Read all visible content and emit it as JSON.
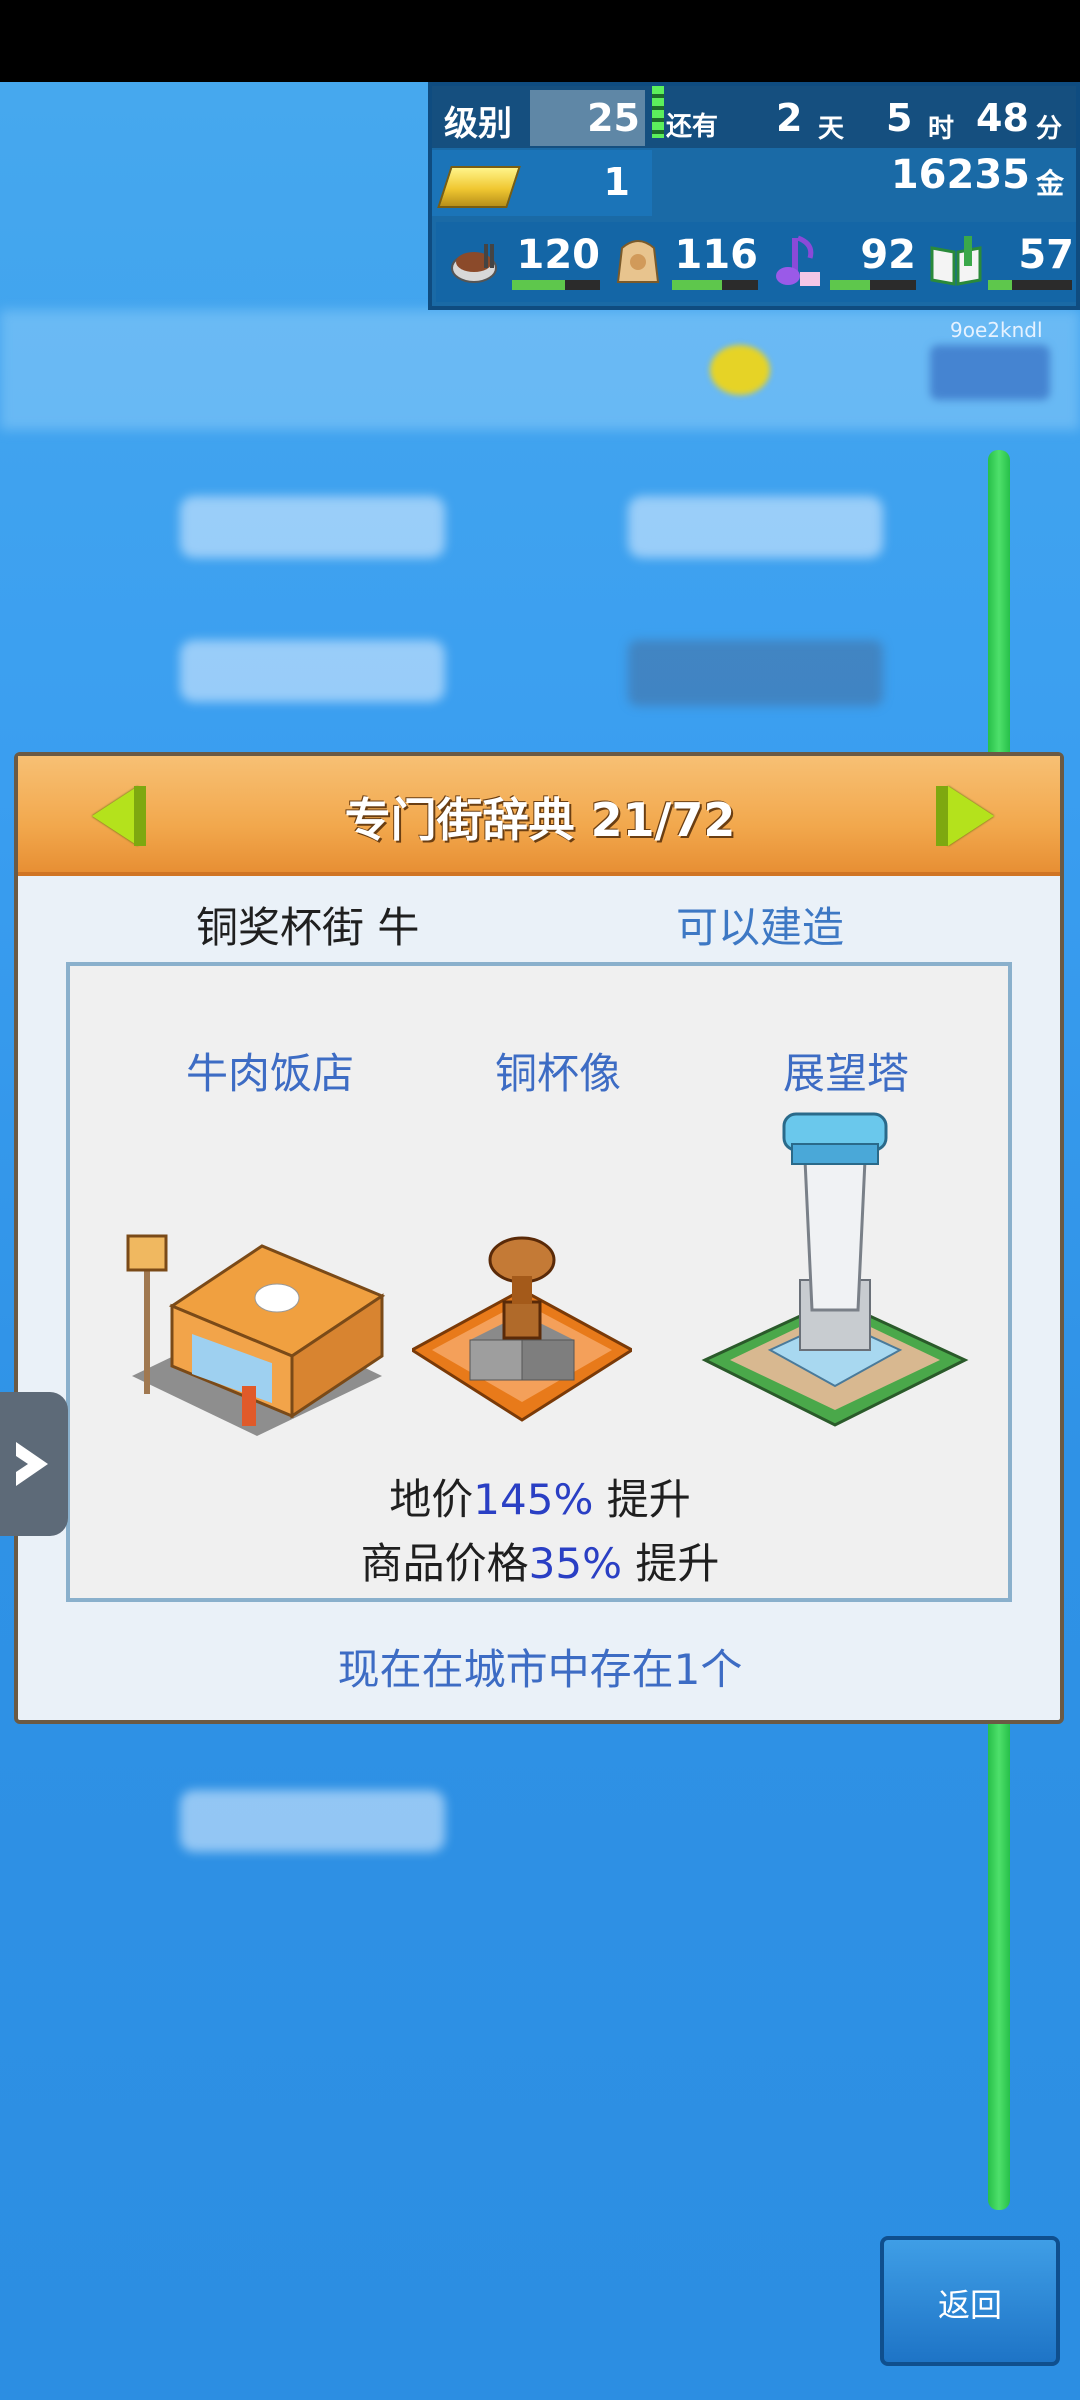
{
  "hud": {
    "level_label": "级别",
    "level_value": "25",
    "remaining_label": "还有",
    "days": "2",
    "days_unit": "天",
    "hours": "5",
    "hours_unit": "时",
    "minutes": "48",
    "minutes_unit": "分",
    "gold_count": "1",
    "money": "16235",
    "money_unit": "金",
    "stats": [
      {
        "icon": "food-icon",
        "value": "120",
        "fill": 0.6
      },
      {
        "icon": "goods-bag-icon",
        "value": "116",
        "fill": 0.58
      },
      {
        "icon": "music-note-icon",
        "value": "92",
        "fill": 0.46
      },
      {
        "icon": "book-icon",
        "value": "57",
        "fill": 0.28
      }
    ]
  },
  "user_id": "9oe2kndl",
  "dialog": {
    "title": "专门街辞典 21/72",
    "street_name": "铜奖杯街 牛",
    "status": "可以建造",
    "buildings": [
      {
        "name": "牛肉饭店",
        "icon": "beef-restaurant-icon"
      },
      {
        "name": "铜杯像",
        "icon": "bronze-cup-statue-icon"
      },
      {
        "name": "展望塔",
        "icon": "observation-tower-icon"
      }
    ],
    "effect1_prefix": "地价",
    "effect1_value": "145%",
    "effect1_suffix": " 提升",
    "effect2_prefix": "商品价格",
    "effect2_value": "35%",
    "effect2_suffix": " 提升",
    "exist_count": "现在在城市中存在1个"
  },
  "back_button": "返回",
  "colors": {
    "header_orange": "#f2a84d",
    "blue_text": "#3d6cc4",
    "highlight": "#2a3fc4",
    "arrow_green": "#b4e21c"
  }
}
